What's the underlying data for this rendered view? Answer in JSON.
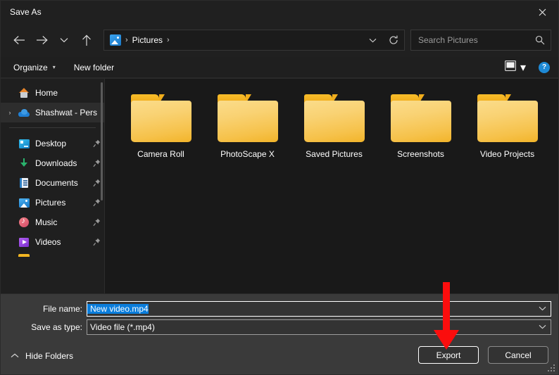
{
  "window": {
    "title": "Save As",
    "close_label": "close-icon"
  },
  "nav": {
    "back": "back-arrow",
    "forward": "forward-arrow",
    "recent": "chevron-down",
    "up": "up-arrow",
    "refresh": "refresh-icon",
    "address_dropdown": "chevron-down"
  },
  "breadcrumb": {
    "icon": "pictures-icon",
    "separator_1": "›",
    "item": "Pictures",
    "separator_2": "›"
  },
  "search": {
    "placeholder": "Search Pictures",
    "icon": "search-icon"
  },
  "commandbar": {
    "organize_label": "Organize",
    "organize_caret": "▾",
    "new_folder_label": "New folder",
    "view_icon": "view-layout-icon",
    "view_caret": "▾",
    "help_label": "?"
  },
  "sidebar": {
    "items": [
      {
        "label": "Home",
        "icon": "home-icon",
        "pinned": false,
        "expander": "",
        "selected": false
      },
      {
        "label": "Shashwat - Pers",
        "icon": "onedrive-icon",
        "pinned": false,
        "expander": "›",
        "selected": true
      }
    ],
    "pinned_items": [
      {
        "label": "Desktop",
        "icon": "desktop-icon",
        "pinned": true
      },
      {
        "label": "Downloads",
        "icon": "downloads-icon",
        "pinned": true
      },
      {
        "label": "Documents",
        "icon": "documents-icon",
        "pinned": true
      },
      {
        "label": "Pictures",
        "icon": "pictures-icon",
        "pinned": true
      },
      {
        "label": "Music",
        "icon": "music-icon",
        "pinned": true
      },
      {
        "label": "Videos",
        "icon": "videos-icon",
        "pinned": true
      }
    ],
    "pin_glyph": "📌"
  },
  "content": {
    "folders": [
      {
        "name": "Camera Roll"
      },
      {
        "name": "PhotoScape X"
      },
      {
        "name": "Saved Pictures"
      },
      {
        "name": "Screenshots"
      },
      {
        "name": "Video Projects"
      }
    ]
  },
  "form": {
    "file_name_label": "File name:",
    "file_name_value": "New video.mp4",
    "save_as_type_label": "Save as type:",
    "save_as_type_value": "Video file (*.mp4)",
    "dropdown_glyph": "⌄"
  },
  "footer": {
    "hide_folders_label": "Hide Folders",
    "hide_folders_caret": "⌃",
    "export_label": "Export",
    "cancel_label": "Cancel"
  },
  "annotation": {
    "arrow_color": "#fb0d0d",
    "points_to": "Export"
  }
}
